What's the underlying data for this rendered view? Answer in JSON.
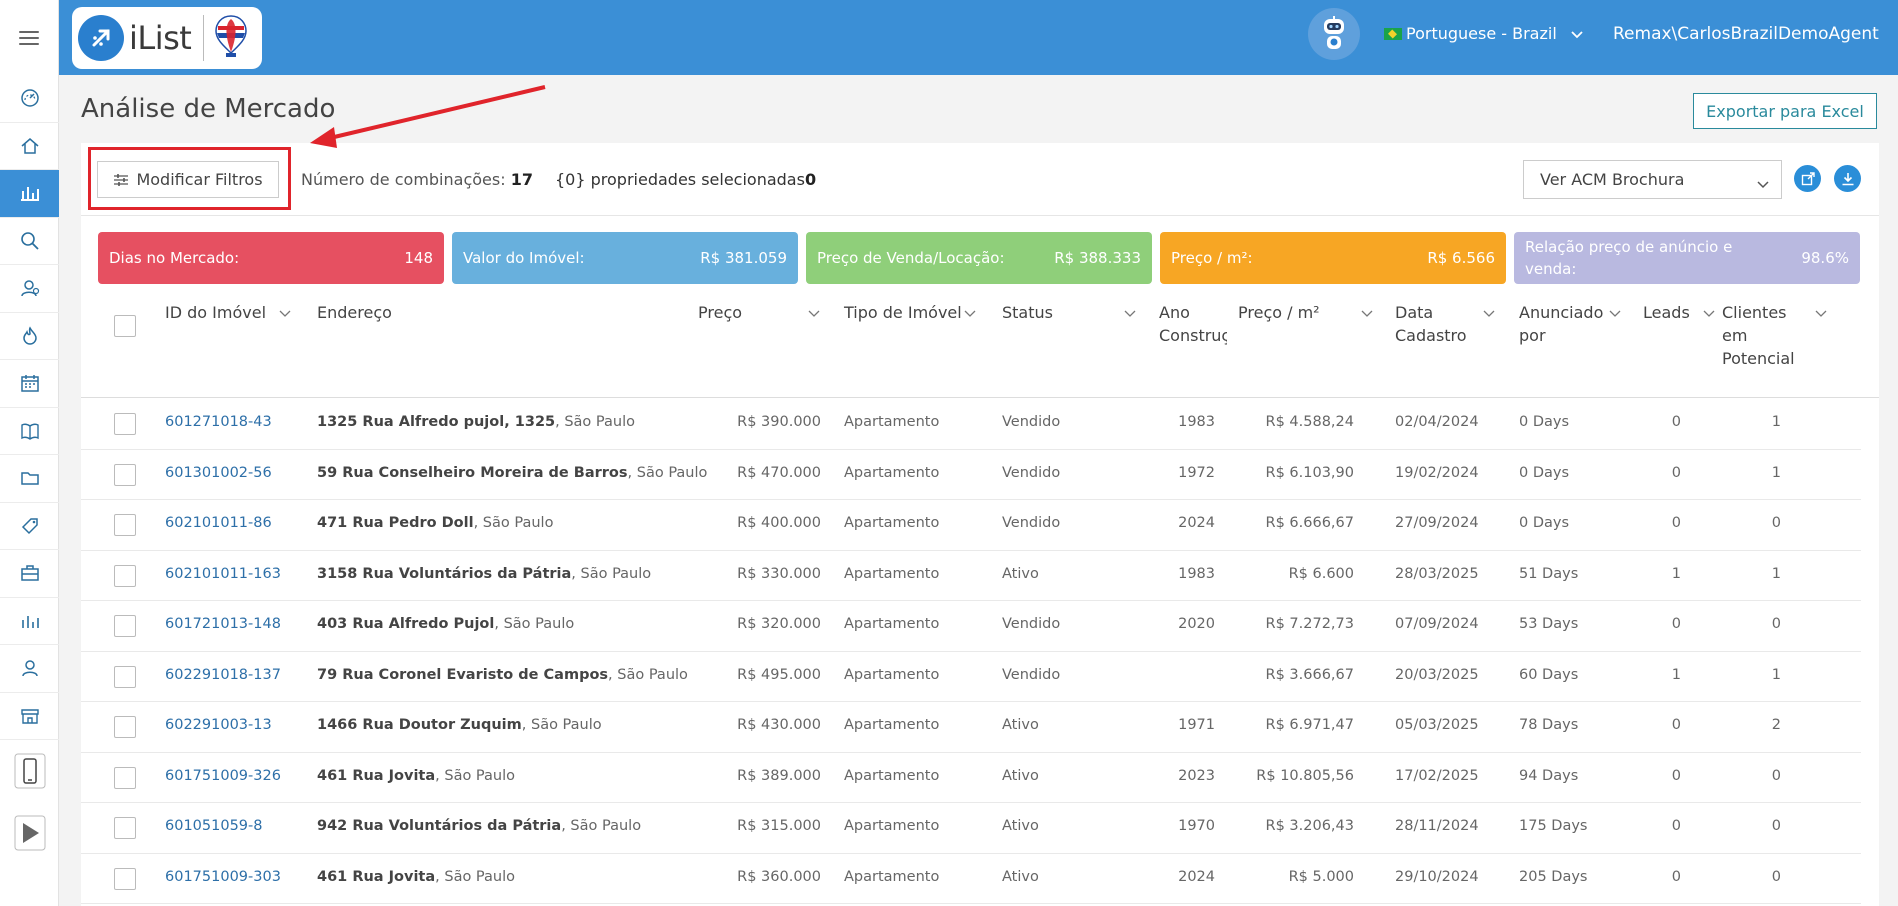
{
  "app": {
    "logo_text": "iList",
    "language": "Portuguese - Brazil",
    "user": "Remax\\CarlosBrazilDemoAgent"
  },
  "sidebar": {
    "items": [
      {
        "icon": "dashboard-gauge-icon"
      },
      {
        "icon": "home-icon"
      },
      {
        "icon": "bar-chart-icon",
        "active": true
      },
      {
        "icon": "search-icon"
      },
      {
        "icon": "contacts-icon"
      },
      {
        "icon": "flame-icon"
      },
      {
        "icon": "calendar-icon"
      },
      {
        "icon": "book-icon"
      },
      {
        "icon": "folder-icon"
      },
      {
        "icon": "tag-icon"
      },
      {
        "icon": "briefcase-icon"
      },
      {
        "icon": "reports-chart-icon"
      },
      {
        "icon": "user-icon"
      },
      {
        "icon": "store-icon"
      },
      {
        "icon": "mobile-phone-icon"
      },
      {
        "icon": "google-play-icon"
      }
    ]
  },
  "page": {
    "title": "Análise de Mercado",
    "export_label": "Exportar para Excel"
  },
  "toolbar": {
    "filter_label": "Modificar Filtros",
    "matches_label": "Número de combinações:",
    "matches_value": "17",
    "selected_label": "{0} propriedades selecionadas",
    "selected_value": "0",
    "acm_select": "Ver ACM Brochura"
  },
  "stats": [
    {
      "label": "Dias no Mercado:",
      "value": "148",
      "color": "#e65061"
    },
    {
      "label": "Valor do Imóvel:",
      "value": "R$ 381.059",
      "color": "#68b0dd"
    },
    {
      "label": "Preço de Venda/Locação:",
      "value": "R$ 388.333",
      "color": "#8fcf7a"
    },
    {
      "label": "Preço / m²:",
      "value": "R$ 6.566",
      "color": "#f7a624"
    },
    {
      "label": "Relação preço de anúncio e venda:",
      "value": "98.6%",
      "color": "#b9b9e0"
    }
  ],
  "table": {
    "headers": {
      "id": "ID do Imóvel",
      "address": "Endereço",
      "price": "Preço",
      "type": "Tipo de Imóvel",
      "status": "Status",
      "year": "Ano Construç",
      "price_m2": "Preço / m²",
      "date": "Data Cadastro",
      "listed_by": "Anunciado por",
      "leads": "Leads",
      "clients": "Clientes em Potencial"
    },
    "rows": [
      {
        "id": "601271018-43",
        "street": "1325 Rua Alfredo pujol, 1325",
        "city": ", São Paulo",
        "price": "R$ 390.000",
        "type": "Apartamento",
        "status": "Vendido",
        "year": "1983",
        "price_m2": "R$ 4.588,24",
        "date": "02/04/2024",
        "listed": "0 Days",
        "leads": "0",
        "clients": "1"
      },
      {
        "id": "601301002-56",
        "street": "59 Rua Conselheiro Moreira de Barros",
        "city": ", São Paulo",
        "price": "R$ 470.000",
        "type": "Apartamento",
        "status": "Vendido",
        "year": "1972",
        "price_m2": "R$ 6.103,90",
        "date": "19/02/2024",
        "listed": "0 Days",
        "leads": "0",
        "clients": "1"
      },
      {
        "id": "602101011-86",
        "street": "471 Rua Pedro Doll",
        "city": ", São Paulo",
        "price": "R$ 400.000",
        "type": "Apartamento",
        "status": "Vendido",
        "year": "2024",
        "price_m2": "R$ 6.666,67",
        "date": "27/09/2024",
        "listed": "0 Days",
        "leads": "0",
        "clients": "0"
      },
      {
        "id": "602101011-163",
        "street": "3158 Rua Voluntários da Pátria",
        "city": ", São Paulo",
        "price": "R$ 330.000",
        "type": "Apartamento",
        "status": "Ativo",
        "year": "1983",
        "price_m2": "R$ 6.600",
        "date": "28/03/2025",
        "listed": "51 Days",
        "leads": "1",
        "clients": "1"
      },
      {
        "id": "601721013-148",
        "street": "403 Rua Alfredo Pujol",
        "city": ", São Paulo",
        "price": "R$ 320.000",
        "type": "Apartamento",
        "status": "Vendido",
        "year": "2020",
        "price_m2": "R$ 7.272,73",
        "date": "07/09/2024",
        "listed": "53 Days",
        "leads": "0",
        "clients": "0"
      },
      {
        "id": "602291018-137",
        "street": "79 Rua Coronel Evaristo de Campos",
        "city": ", São Paulo",
        "price": "R$ 495.000",
        "type": "Apartamento",
        "status": "Vendido",
        "year": "",
        "price_m2": "R$ 3.666,67",
        "date": "20/03/2025",
        "listed": "60 Days",
        "leads": "1",
        "clients": "1"
      },
      {
        "id": "602291003-13",
        "street": "1466 Rua Doutor Zuquim",
        "city": ", São Paulo",
        "price": "R$ 430.000",
        "type": "Apartamento",
        "status": "Ativo",
        "year": "1971",
        "price_m2": "R$ 6.971,47",
        "date": "05/03/2025",
        "listed": "78 Days",
        "leads": "0",
        "clients": "2"
      },
      {
        "id": "601751009-326",
        "street": "461 Rua Jovita",
        "city": ", São Paulo",
        "price": "R$ 389.000",
        "type": "Apartamento",
        "status": "Ativo",
        "year": "2023",
        "price_m2": "R$ 10.805,56",
        "date": "17/02/2025",
        "listed": "94 Days",
        "leads": "0",
        "clients": "0"
      },
      {
        "id": "601051059-8",
        "street": "942 Rua Voluntários da Pátria",
        "city": ", São Paulo",
        "price": "R$ 315.000",
        "type": "Apartamento",
        "status": "Ativo",
        "year": "1970",
        "price_m2": "R$ 3.206,43",
        "date": "28/11/2024",
        "listed": "175 Days",
        "leads": "0",
        "clients": "0"
      },
      {
        "id": "601751009-303",
        "street": "461 Rua Jovita",
        "city": ", São Paulo",
        "price": "R$ 360.000",
        "type": "Apartamento",
        "status": "Ativo",
        "year": "2024",
        "price_m2": "R$ 5.000",
        "date": "29/10/2024",
        "listed": "205 Days",
        "leads": "0",
        "clients": "0"
      }
    ]
  },
  "colors": {
    "header_blue": "#3b8fd6",
    "annotation_red": "#e0242b",
    "link_blue": "#2d6fa8",
    "export_teal": "#2a8a9c"
  }
}
